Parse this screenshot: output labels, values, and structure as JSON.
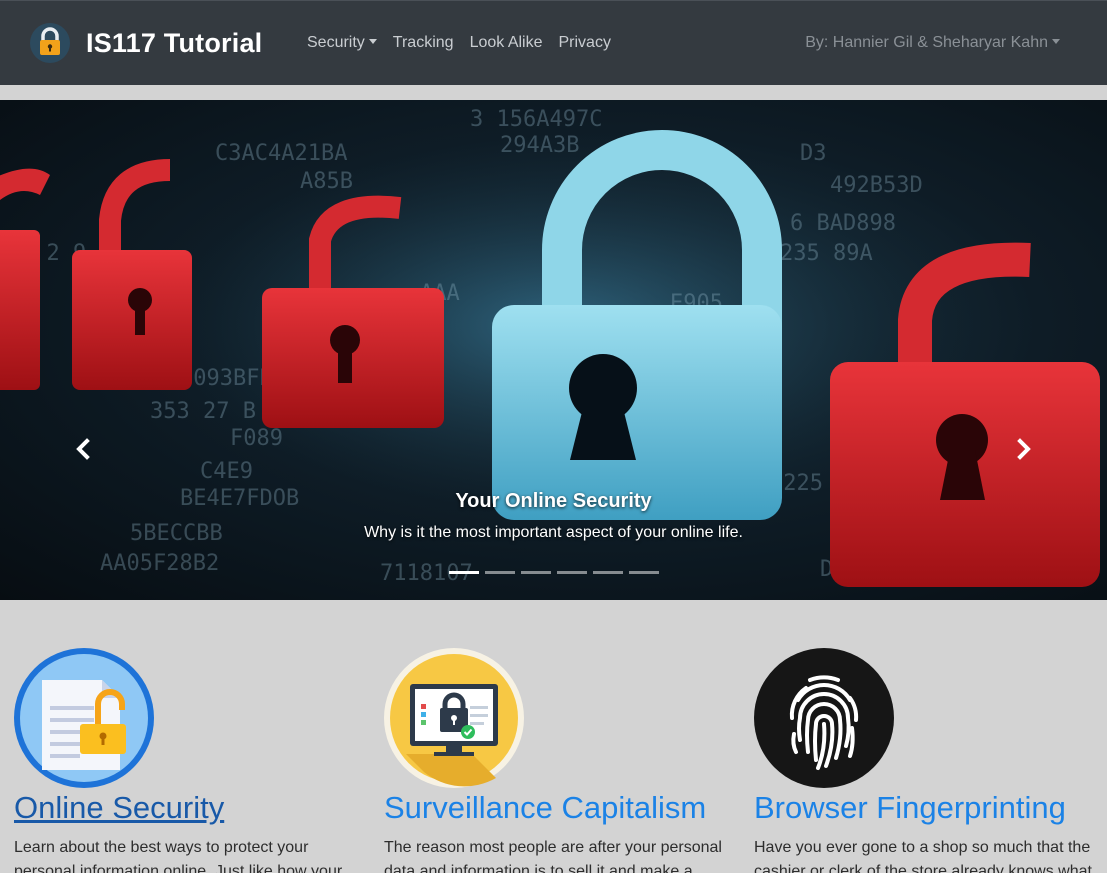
{
  "brand": {
    "title": "IS117 Tutorial"
  },
  "nav": {
    "items": [
      {
        "label": "Security",
        "dropdown": true
      },
      {
        "label": "Tracking",
        "dropdown": false
      },
      {
        "label": "Look Alike",
        "dropdown": false
      },
      {
        "label": "Privacy",
        "dropdown": false
      }
    ],
    "author": "By: Hannier Gil & Sheharyar Kahn"
  },
  "carousel": {
    "caption_title": "Your Online Security",
    "caption_text": "Why is it the most important aspect of your online life.",
    "slide_count": 6,
    "active_index": 0
  },
  "cards": [
    {
      "title": "Online Security",
      "description": "Learn about the best ways to protect your personal information online. Just like how your",
      "icon": "document-padlock-icon"
    },
    {
      "title": "Surveillance Capitalism",
      "description": "The reason most people are after your personal data and information is to sell it and make a",
      "icon": "monitor-padlock-icon"
    },
    {
      "title": "Browser Fingerprinting",
      "description": "Have you ever gone to a shop so much that the cashier or clerk of the store already knows what",
      "icon": "fingerprint-icon"
    }
  ],
  "colors": {
    "navbar": "#343a40",
    "link": "#1b82e6",
    "link_visited": "#1859a8",
    "page_bg": "#d3d3d3"
  }
}
